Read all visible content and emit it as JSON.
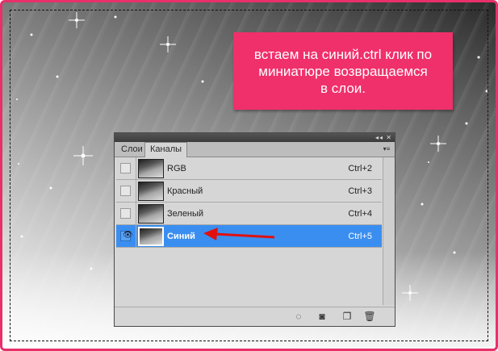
{
  "annotation": {
    "lines": [
      "встаем на синий.ctrl клик по",
      "миниатюре возвращаемся",
      "в слои."
    ],
    "background_color": "#f0306b"
  },
  "panel": {
    "titlebar_controls": "◂◂ ✕",
    "tabs": [
      {
        "label": "Слои",
        "active": false
      },
      {
        "label": "Каналы",
        "active": true
      }
    ],
    "menu_icon": "panel-menu-icon",
    "channels": [
      {
        "name": "RGB",
        "shortcut": "Ctrl+2",
        "visible": false,
        "selected": false
      },
      {
        "name": "Красный",
        "shortcut": "Ctrl+3",
        "visible": false,
        "selected": false
      },
      {
        "name": "Зеленый",
        "shortcut": "Ctrl+4",
        "visible": false,
        "selected": false
      },
      {
        "name": "Синий",
        "shortcut": "Ctrl+5",
        "visible": true,
        "selected": true
      }
    ],
    "footer_icons": [
      "load-channel-as-selection-icon",
      "save-selection-as-channel-icon",
      "new-channel-icon",
      "delete-channel-icon"
    ],
    "selection_color": "#3a8ef0"
  },
  "accent_color": "#e8306a",
  "arrow_color": "#e01010"
}
